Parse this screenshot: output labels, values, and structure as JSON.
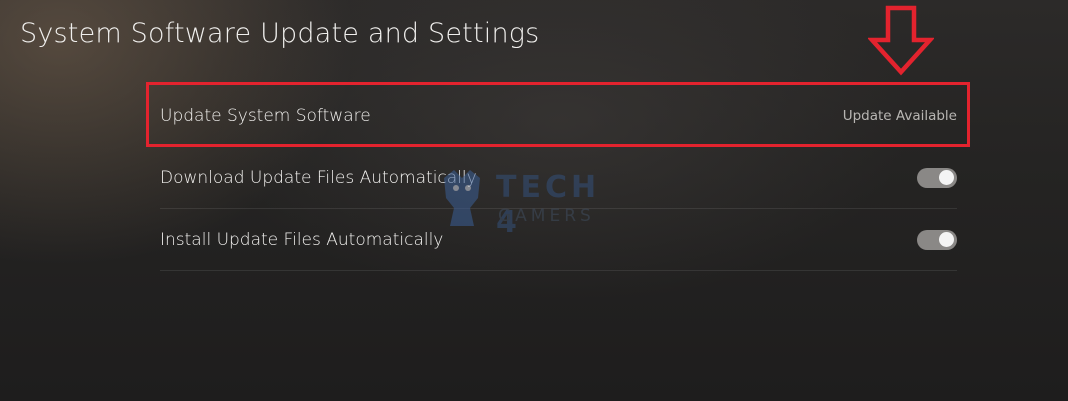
{
  "page": {
    "title": "System Software Update and Settings"
  },
  "settings": {
    "items": [
      {
        "label": "Update System Software",
        "value": "Update Available"
      },
      {
        "label": "Download Update Files Automatically",
        "toggle_on": true
      },
      {
        "label": "Install Update Files Automatically",
        "toggle_on": true
      }
    ]
  },
  "annotations": {
    "highlight_color": "#e3232e",
    "arrow_icon": "down-arrow-outline-icon"
  },
  "watermark": {
    "line1": "TECH 4",
    "line2": "GAMERS"
  }
}
